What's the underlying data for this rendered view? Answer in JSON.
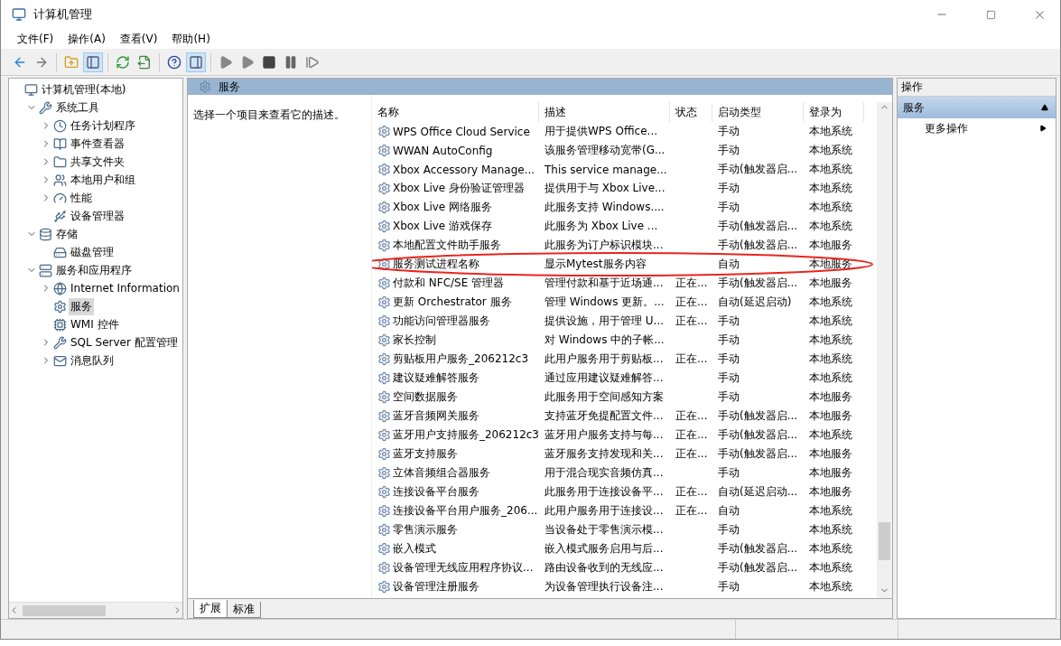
{
  "window": {
    "title": "计算机管理"
  },
  "menu": [
    {
      "label": "文件(F)"
    },
    {
      "label": "操作(A)"
    },
    {
      "label": "查看(V)"
    },
    {
      "label": "帮助(H)"
    }
  ],
  "toolbar": [
    {
      "kind": "back",
      "pressed": false
    },
    {
      "kind": "forward",
      "pressed": false
    },
    {
      "kind": "sep"
    },
    {
      "kind": "up",
      "pressed": false
    },
    {
      "kind": "tree",
      "pressed": true
    },
    {
      "kind": "sep"
    },
    {
      "kind": "refresh",
      "pressed": false
    },
    {
      "kind": "export",
      "pressed": false
    },
    {
      "kind": "sep"
    },
    {
      "kind": "help",
      "pressed": false
    },
    {
      "kind": "pane",
      "pressed": true
    },
    {
      "kind": "sep"
    },
    {
      "kind": "play",
      "pressed": false
    },
    {
      "kind": "play",
      "pressed": false
    },
    {
      "kind": "stop",
      "pressed": false
    },
    {
      "kind": "pause",
      "pressed": false
    },
    {
      "kind": "resume",
      "pressed": false
    }
  ],
  "tree": [
    {
      "label": "计算机管理(本地)",
      "selected": false,
      "children": [
        {
          "label": "系统工具",
          "expanded": true,
          "selected": false,
          "children": [
            {
              "label": "任务计划程序",
              "expanded": false,
              "selected": false
            },
            {
              "label": "事件查看器",
              "expanded": false,
              "selected": false
            },
            {
              "label": "共享文件夹",
              "expanded": false,
              "selected": false
            },
            {
              "label": "本地用户和组",
              "expanded": false,
              "selected": false
            },
            {
              "label": "性能",
              "expanded": false,
              "selected": false
            },
            {
              "label": "设备管理器",
              "selected": false
            }
          ]
        },
        {
          "label": "存储",
          "expanded": true,
          "selected": false,
          "children": [
            {
              "label": "磁盘管理",
              "selected": false
            }
          ]
        },
        {
          "label": "服务和应用程序",
          "expanded": true,
          "selected": false,
          "children": [
            {
              "label": "Internet Information",
              "expanded": false,
              "selected": false
            },
            {
              "label": "服务",
              "selected": true
            },
            {
              "label": "WMI 控件",
              "selected": false
            },
            {
              "label": "SQL Server 配置管理",
              "expanded": false,
              "selected": false
            },
            {
              "label": "消息队列",
              "expanded": false,
              "selected": false
            }
          ]
        }
      ]
    }
  ],
  "services_panel": {
    "title": "服务",
    "description": "选择一个项目来查看它的描述。",
    "columns": [
      "名称",
      "描述",
      "状态",
      "启动类型",
      "登录为"
    ],
    "rows": [
      {
        "name": "WPS Office Cloud Service",
        "description": "用于提供WPS Office...",
        "status": "",
        "startup": "手动",
        "logon": "本地系统",
        "circled": false
      },
      {
        "name": "WWAN AutoConfig",
        "description": "该服务管理移动宽带(G...",
        "status": "",
        "startup": "手动",
        "logon": "本地系统",
        "circled": false
      },
      {
        "name": "Xbox Accessory Manage...",
        "description": "This service manage...",
        "status": "",
        "startup": "手动(触发器启...",
        "logon": "本地系统",
        "circled": false
      },
      {
        "name": "Xbox Live 身份验证管理器",
        "description": "提供用于与 Xbox Live...",
        "status": "",
        "startup": "手动",
        "logon": "本地系统",
        "circled": false
      },
      {
        "name": "Xbox Live 网络服务",
        "description": "此服务支持 Windows....",
        "status": "",
        "startup": "手动",
        "logon": "本地系统",
        "circled": false
      },
      {
        "name": "Xbox Live 游戏保存",
        "description": "此服务为 Xbox Live ...",
        "status": "",
        "startup": "手动(触发器启...",
        "logon": "本地系统",
        "circled": false
      },
      {
        "name": "本地配置文件助手服务",
        "description": "此服务为订户标识模块...",
        "status": "",
        "startup": "手动(触发器启...",
        "logon": "本地服务",
        "circled": false
      },
      {
        "name": "服务测试进程名称",
        "description": "显示Mytest服务内容",
        "status": "",
        "startup": "自动",
        "logon": "本地服务",
        "circled": true
      },
      {
        "name": "付款和 NFC/SE 管理器",
        "description": "管理付款和基于近场通...",
        "status": "正在...",
        "startup": "手动(触发器启...",
        "logon": "本地服务",
        "circled": false
      },
      {
        "name": "更新 Orchestrator 服务",
        "description": "管理 Windows 更新。...",
        "status": "正在...",
        "startup": "自动(延迟启动)",
        "logon": "本地系统",
        "circled": false
      },
      {
        "name": "功能访问管理器服务",
        "description": "提供设施，用于管理 U...",
        "status": "正在...",
        "startup": "手动",
        "logon": "本地系统",
        "circled": false
      },
      {
        "name": "家长控制",
        "description": "对 Windows 中的子帐...",
        "status": "",
        "startup": "手动",
        "logon": "本地系统",
        "circled": false
      },
      {
        "name": "剪贴板用户服务_206212c3",
        "description": "此用户服务用于剪贴板...",
        "status": "正在...",
        "startup": "手动",
        "logon": "本地系统",
        "circled": false
      },
      {
        "name": "建议疑难解答服务",
        "description": "通过应用建议疑难解答...",
        "status": "",
        "startup": "手动",
        "logon": "本地系统",
        "circled": false
      },
      {
        "name": "空间数据服务",
        "description": "此服务用于空间感知方案",
        "status": "",
        "startup": "手动",
        "logon": "本地服务",
        "circled": false
      },
      {
        "name": "蓝牙音频网关服务",
        "description": "支持蓝牙免提配置文件...",
        "status": "正在...",
        "startup": "手动(触发器启...",
        "logon": "本地服务",
        "circled": false
      },
      {
        "name": "蓝牙用户支持服务_206212c3",
        "description": "蓝牙用户服务支持与每...",
        "status": "正在...",
        "startup": "手动(触发器启...",
        "logon": "本地系统",
        "circled": false
      },
      {
        "name": "蓝牙支持服务",
        "description": "蓝牙服务支持发现和关...",
        "status": "正在...",
        "startup": "手动(触发器启...",
        "logon": "本地服务",
        "circled": false
      },
      {
        "name": "立体音频组合器服务",
        "description": "用于混合现实音频仿真...",
        "status": "",
        "startup": "手动",
        "logon": "本地服务",
        "circled": false
      },
      {
        "name": "连接设备平台服务",
        "description": "此服务用于连接设备平...",
        "status": "正在...",
        "startup": "自动(延迟启动...",
        "logon": "本地服务",
        "circled": false
      },
      {
        "name": "连接设备平台用户服务_206...",
        "description": "此用户服务用于连接设...",
        "status": "正在...",
        "startup": "自动",
        "logon": "本地系统",
        "circled": false
      },
      {
        "name": "零售演示服务",
        "description": "当设备处于零售演示模...",
        "status": "",
        "startup": "手动",
        "logon": "本地系统",
        "circled": false
      },
      {
        "name": "嵌入模式",
        "description": "嵌入模式服务启用与后...",
        "status": "",
        "startup": "手动(触发器启...",
        "logon": "本地系统",
        "circled": false
      },
      {
        "name": "设备管理无线应用程序协议...",
        "description": "路由设备收到的无线应...",
        "status": "",
        "startup": "手动(触发器启...",
        "logon": "本地系统",
        "circled": false
      },
      {
        "name": "设备管理注册服务",
        "description": "为设备管理执行设备注...",
        "status": "",
        "startup": "手动",
        "logon": "本地系统",
        "circled": false
      }
    ]
  },
  "tabs": [
    {
      "label": "扩展",
      "selected": true
    },
    {
      "label": "标准",
      "selected": false
    }
  ],
  "actions": {
    "title": "操作",
    "section": "服务",
    "items": [
      "更多操作"
    ]
  }
}
